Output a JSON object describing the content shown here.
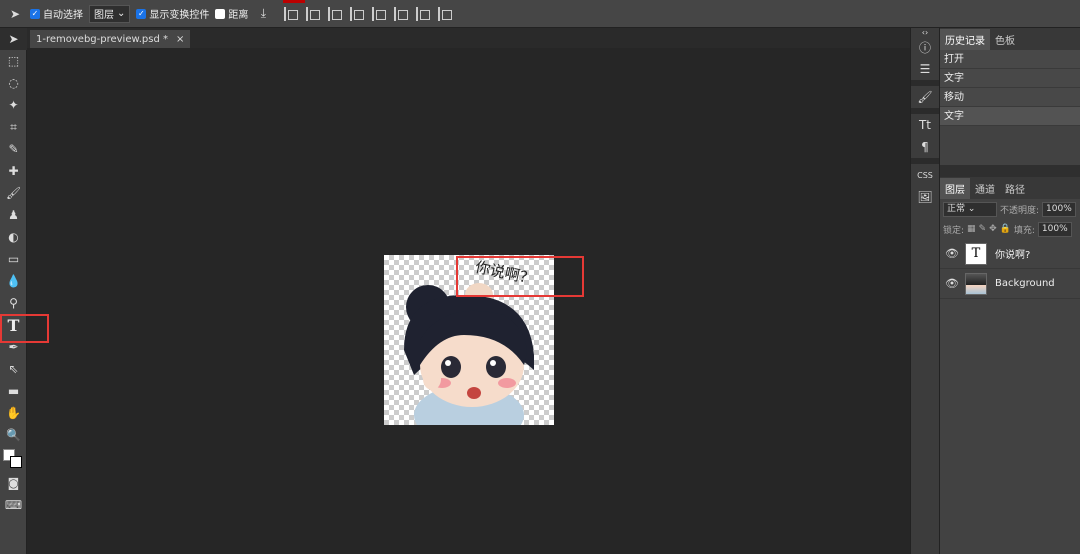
{
  "options_bar": {
    "auto_select_label": "自动选择",
    "layer_select_value": "图层",
    "show_transform_label": "显示变换控件",
    "distance_label": "距离"
  },
  "document": {
    "tab_title": "1-removebg-preview.psd *",
    "close_glyph": "×",
    "canvas_text": "你说啊？"
  },
  "history_panel": {
    "tabs": [
      "历史记录",
      "色板"
    ],
    "items": [
      "打开",
      "文字",
      "移动",
      "文字"
    ]
  },
  "layers_panel": {
    "tabs": [
      "图层",
      "通道",
      "路径"
    ],
    "blend_mode": "正常",
    "opacity_label": "不透明度:",
    "opacity_value": "100%",
    "lock_label": "锁定:",
    "fill_label": "填充:",
    "fill_value": "100%",
    "layers": [
      {
        "name": "你说啊?",
        "thumb": "T"
      },
      {
        "name": "Background",
        "thumb": ""
      }
    ]
  },
  "side_icons": {
    "css_label": "CSS"
  },
  "colors": {
    "highlight": "#e53935",
    "checkbox": "#1a73e8"
  }
}
